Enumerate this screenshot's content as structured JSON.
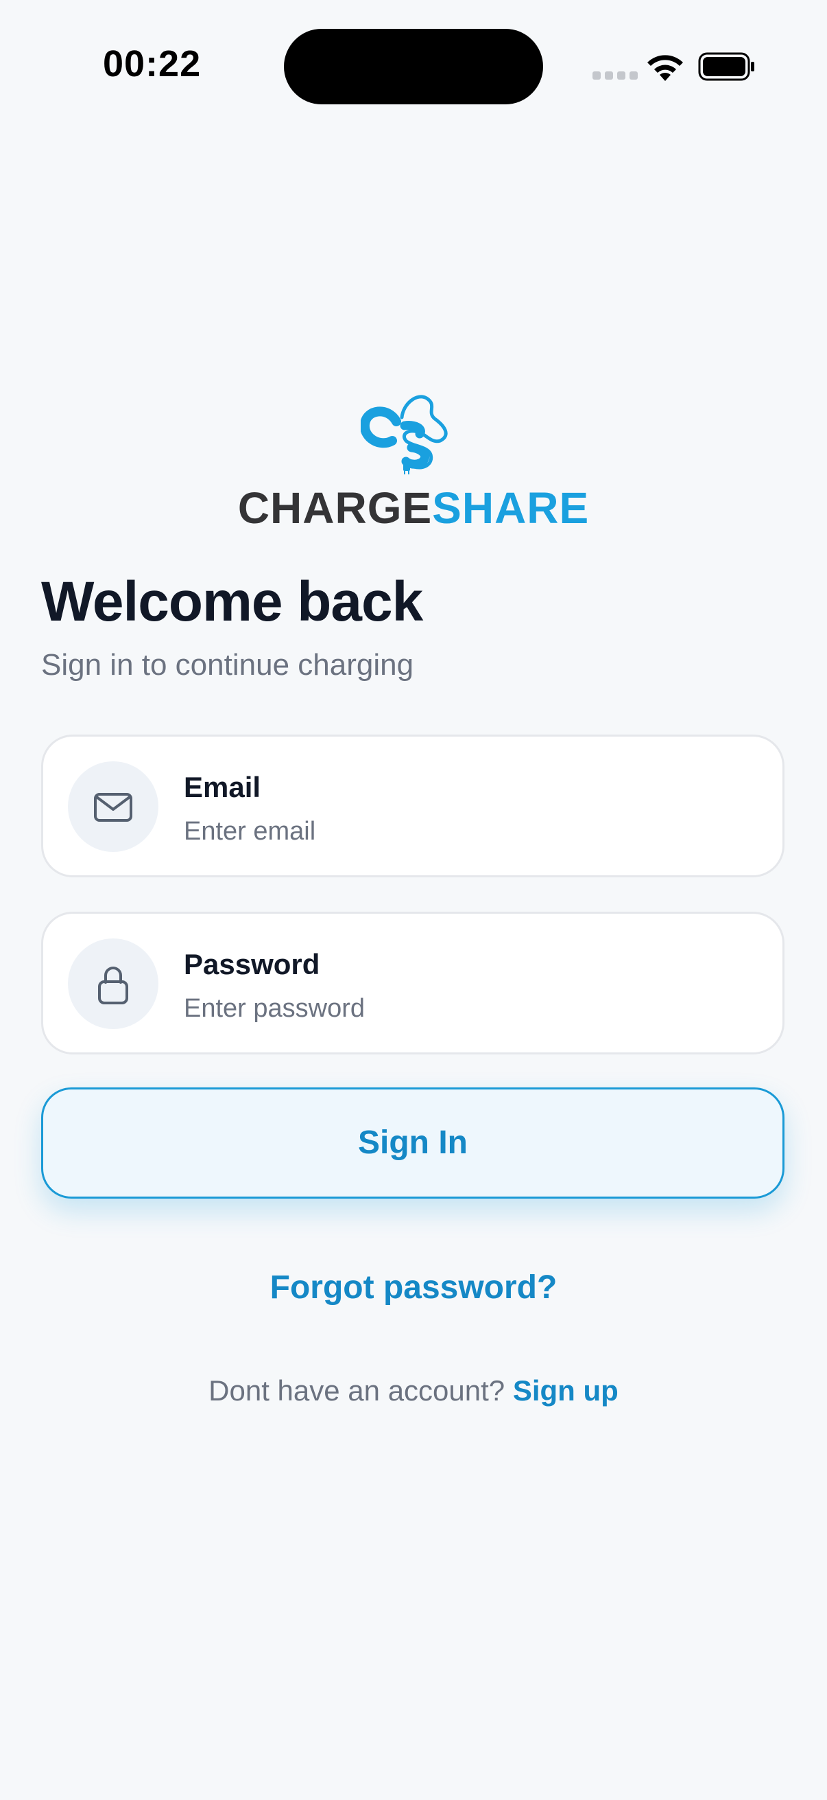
{
  "status_bar": {
    "time": "00:22",
    "icons": [
      "cellular-signal-icon",
      "wifi-icon",
      "battery-icon"
    ]
  },
  "logo": {
    "icon": "chargeshare-logo-icon",
    "word_part1": "CHARGE",
    "word_part2": "SHARE"
  },
  "header": {
    "title": "Welcome back",
    "subtitle": "Sign in to continue charging"
  },
  "form": {
    "email": {
      "icon": "mail-icon",
      "label": "Email",
      "value": "",
      "placeholder": "Enter email"
    },
    "password": {
      "icon": "lock-icon",
      "label": "Password",
      "value": "",
      "placeholder": "Enter password"
    },
    "submit_label": "Sign In"
  },
  "links": {
    "forgot_password": "Forgot password?",
    "signup_prompt": "Dont have an account? ",
    "signup_link": "Sign up"
  },
  "colors": {
    "background": "#f6f8fa",
    "accent": "#1588c6",
    "brand_blue": "#1aa0df",
    "brand_dark": "#343436",
    "text_primary": "#111827",
    "text_secondary": "#6b7280"
  }
}
